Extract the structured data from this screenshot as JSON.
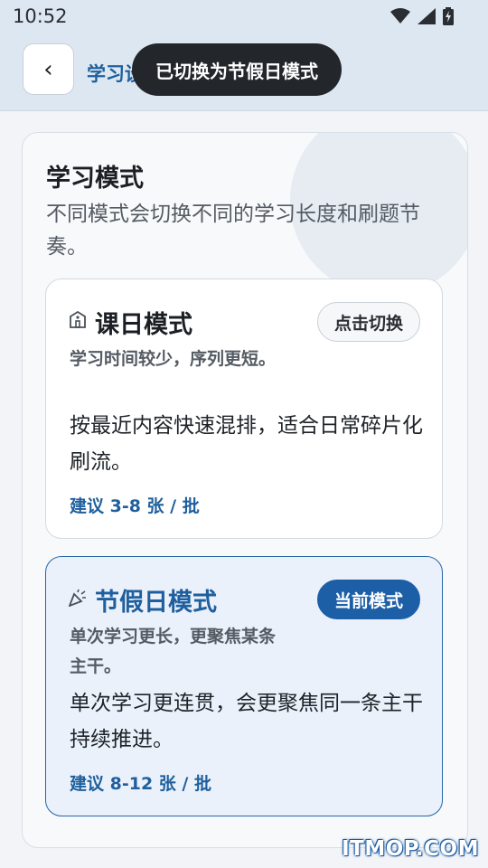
{
  "status_bar": {
    "time": "10:52",
    "icons": [
      "wifi-icon",
      "signal-icon",
      "battery-charging-icon"
    ]
  },
  "header": {
    "back_icon": "‹",
    "title": "学习设置"
  },
  "toast": {
    "message": "已切换为节假日模式"
  },
  "section": {
    "title": "学习模式",
    "description": "不同模式会切换不同的学习长度和刷题节奏。"
  },
  "modes": [
    {
      "icon": "school-icon",
      "name": "课日模式",
      "subtitle": "学习时间较少，序列更短。",
      "description": "按最近内容快速混排，适合日常碎片化刷流。",
      "hint": "建议 3-8 张 / 批",
      "button_label": "点击切换",
      "active": false
    },
    {
      "icon": "party-popper-icon",
      "name": "节假日模式",
      "subtitle": "单次学习更长，更聚焦某条主干。",
      "description": "单次学习更连贯，会更聚焦同一条主干持续推进。",
      "hint": "建议 8-12 张 / 批",
      "button_label": "当前模式",
      "active": true
    }
  ],
  "watermark": "ITMOP.COM",
  "colors": {
    "accent": "#1d5fa6",
    "header_bg": "#dde7f2",
    "active_card_bg": "#eaf1fb"
  }
}
